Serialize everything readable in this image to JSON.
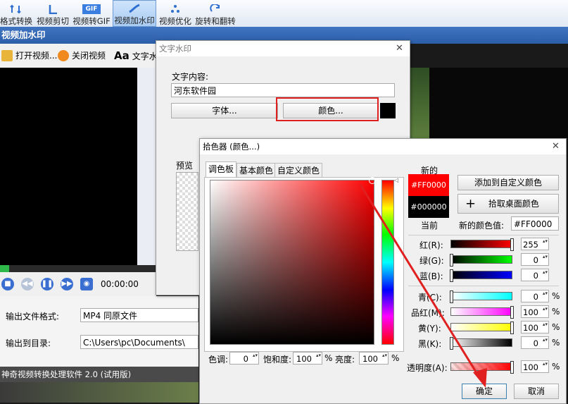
{
  "ribbon": {
    "items": [
      {
        "label": "格式转换"
      },
      {
        "label": "视频剪切"
      },
      {
        "label": "视频转GIF",
        "icon_text": "GIF"
      },
      {
        "label": "视频加水印",
        "active": true
      },
      {
        "label": "视频优化"
      },
      {
        "label": "旋转和翻转"
      }
    ]
  },
  "app": {
    "title": "视频加水印",
    "toolbar": {
      "open": "打开视频...",
      "close": "关闭视频",
      "text": "文字水"
    },
    "player": {
      "time": "00:00:00",
      "progress": 0.06
    },
    "output_format_label": "输出文件格式:",
    "output_format_value": "MP4 同原文件",
    "output_dir_label": "输出到目录:",
    "output_dir_value": "C:\\Users\\pc\\Documents\\",
    "status": "神奇视频转换处理软件 2.0 (试用版)"
  },
  "watermark_dialog": {
    "title": "文字水印",
    "content_label": "文字内容:",
    "content_value": "河东软件园",
    "font_button": "字体...",
    "color_button": "颜色...",
    "preview_label": "预览",
    "swatch_color": "#000000"
  },
  "color_picker": {
    "title": "拾色器 (颜色...)",
    "tabs": [
      "调色板",
      "基本颜色",
      "自定义颜色"
    ],
    "active_tab": 0,
    "new_label": "新的",
    "current_label": "当前",
    "new_hex": "#FF0000",
    "current_hex": "#000000",
    "add_custom": "添加到自定义颜色",
    "pick_desktop": "拾取桌面颜色",
    "new_value_label": "新的颜色值:",
    "new_value": "#FF0000",
    "rgb": {
      "r_label": "红(R):",
      "g_label": "绿(G):",
      "b_label": "蓝(B):",
      "r": "255",
      "g": "0",
      "b": "0"
    },
    "cmyk": {
      "c_label": "青(C):",
      "m_label": "品红(M):",
      "y_label": "黄(Y):",
      "k_label": "黑(K):",
      "c": "0",
      "m": "100",
      "y": "100",
      "k": "0"
    },
    "pct": "%",
    "hue_label": "色调:",
    "hue": "0",
    "sat_label": "饱和度:",
    "sat": "100",
    "bri_label": "亮度:",
    "bri": "100",
    "opacity_label": "透明度(A):",
    "opacity": "100",
    "ok": "确定",
    "cancel": "取消",
    "colors": {
      "accent": "#e0201f",
      "new": "#ff0000",
      "current": "#000000"
    }
  }
}
